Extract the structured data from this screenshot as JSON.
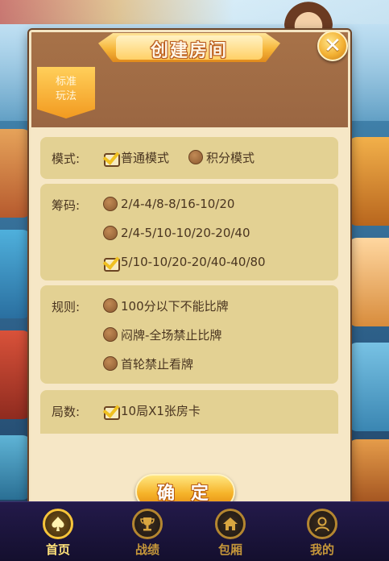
{
  "dialog": {
    "title": "创建房间",
    "close_icon": "close-icon",
    "tab_label_line1": "标准",
    "tab_label_line2": "玩法"
  },
  "mode": {
    "label": "模式:",
    "options": [
      {
        "label": "普通模式",
        "selected": true
      },
      {
        "label": "积分模式",
        "selected": false
      }
    ]
  },
  "chips": {
    "label": "筹码:",
    "options": [
      {
        "label": "2/4-4/8-8/16-10/20",
        "selected": false
      },
      {
        "label": "2/4-5/10-10/20-20/40",
        "selected": false
      },
      {
        "label": "5/10-10/20-20/40-40/80",
        "selected": true
      }
    ]
  },
  "rules": {
    "label": "规则:",
    "options": [
      {
        "label": "100分以下不能比牌",
        "selected": false
      },
      {
        "label": "闷牌-全场禁止比牌",
        "selected": false
      },
      {
        "label": "首轮禁止看牌",
        "selected": false
      }
    ]
  },
  "rounds": {
    "label": "局数:",
    "options": [
      {
        "label": "10局X1张房卡",
        "selected": true
      }
    ]
  },
  "confirm_label": "确 定",
  "nav": [
    {
      "label": "首页",
      "icon": "spade-icon",
      "active": true
    },
    {
      "label": "战绩",
      "icon": "trophy-icon",
      "active": false
    },
    {
      "label": "包厢",
      "icon": "house-icon",
      "active": false
    },
    {
      "label": "我的",
      "icon": "user-icon",
      "active": false
    }
  ],
  "colors": {
    "panel": "#f6e7c6",
    "section": "#e3d193",
    "header": "#9c6b44",
    "accent": "#f6b42a",
    "nav_bg": "#1b1438"
  }
}
